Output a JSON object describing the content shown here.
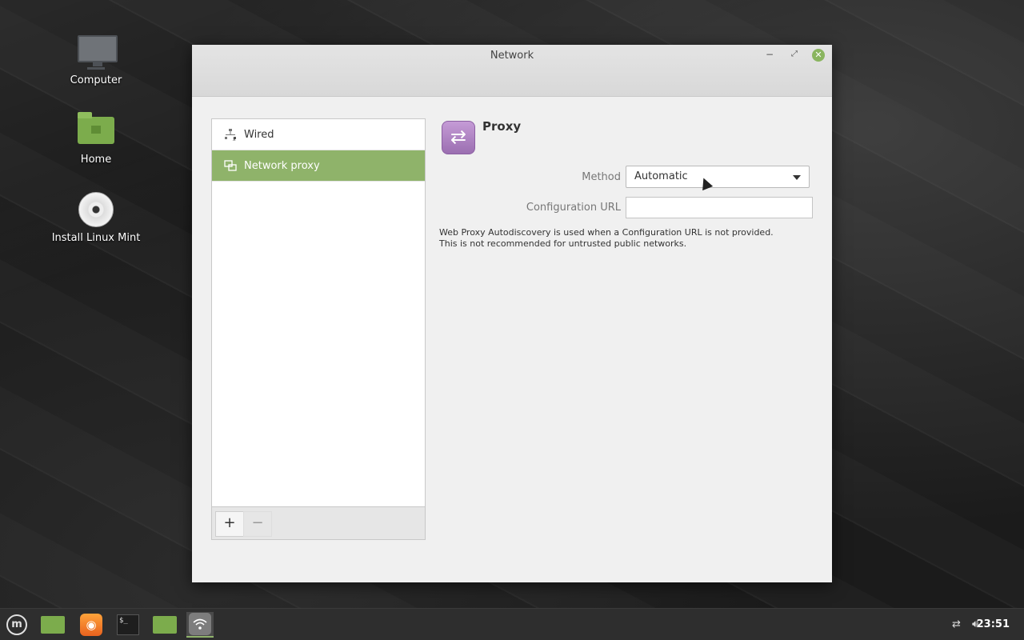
{
  "desktop": {
    "icons": [
      {
        "label": "Computer",
        "icon": "computer-icon"
      },
      {
        "label": "Home",
        "icon": "home-folder-icon"
      },
      {
        "label": "Install Linux Mint",
        "icon": "disc-icon"
      }
    ]
  },
  "window": {
    "title": "Network",
    "controls": {
      "minimize": "−",
      "maximize": "⤢",
      "close": "✕"
    }
  },
  "sidebar": {
    "items": [
      {
        "label": "Wired",
        "icon": "wired-network-icon",
        "active": false
      },
      {
        "label": "Network proxy",
        "icon": "proxy-icon",
        "active": true
      }
    ],
    "add_label": "+",
    "remove_label": "−"
  },
  "proxy": {
    "heading": "Proxy",
    "method_label": "Method",
    "method_value": "Automatic",
    "config_url_label": "Configuration URL",
    "config_url_value": "",
    "note_line1": "Web Proxy Autodiscovery is used when a Configuration URL is not provided.",
    "note_line2": "This is not recommended for untrusted public networks."
  },
  "taskbar": {
    "menu_logo": "m",
    "terminal_text": "$_",
    "clock": "23:51"
  },
  "colors": {
    "accent": "#8fb36a",
    "close_button": "#8ab55f",
    "proxy_icon": "#b07fc7"
  }
}
